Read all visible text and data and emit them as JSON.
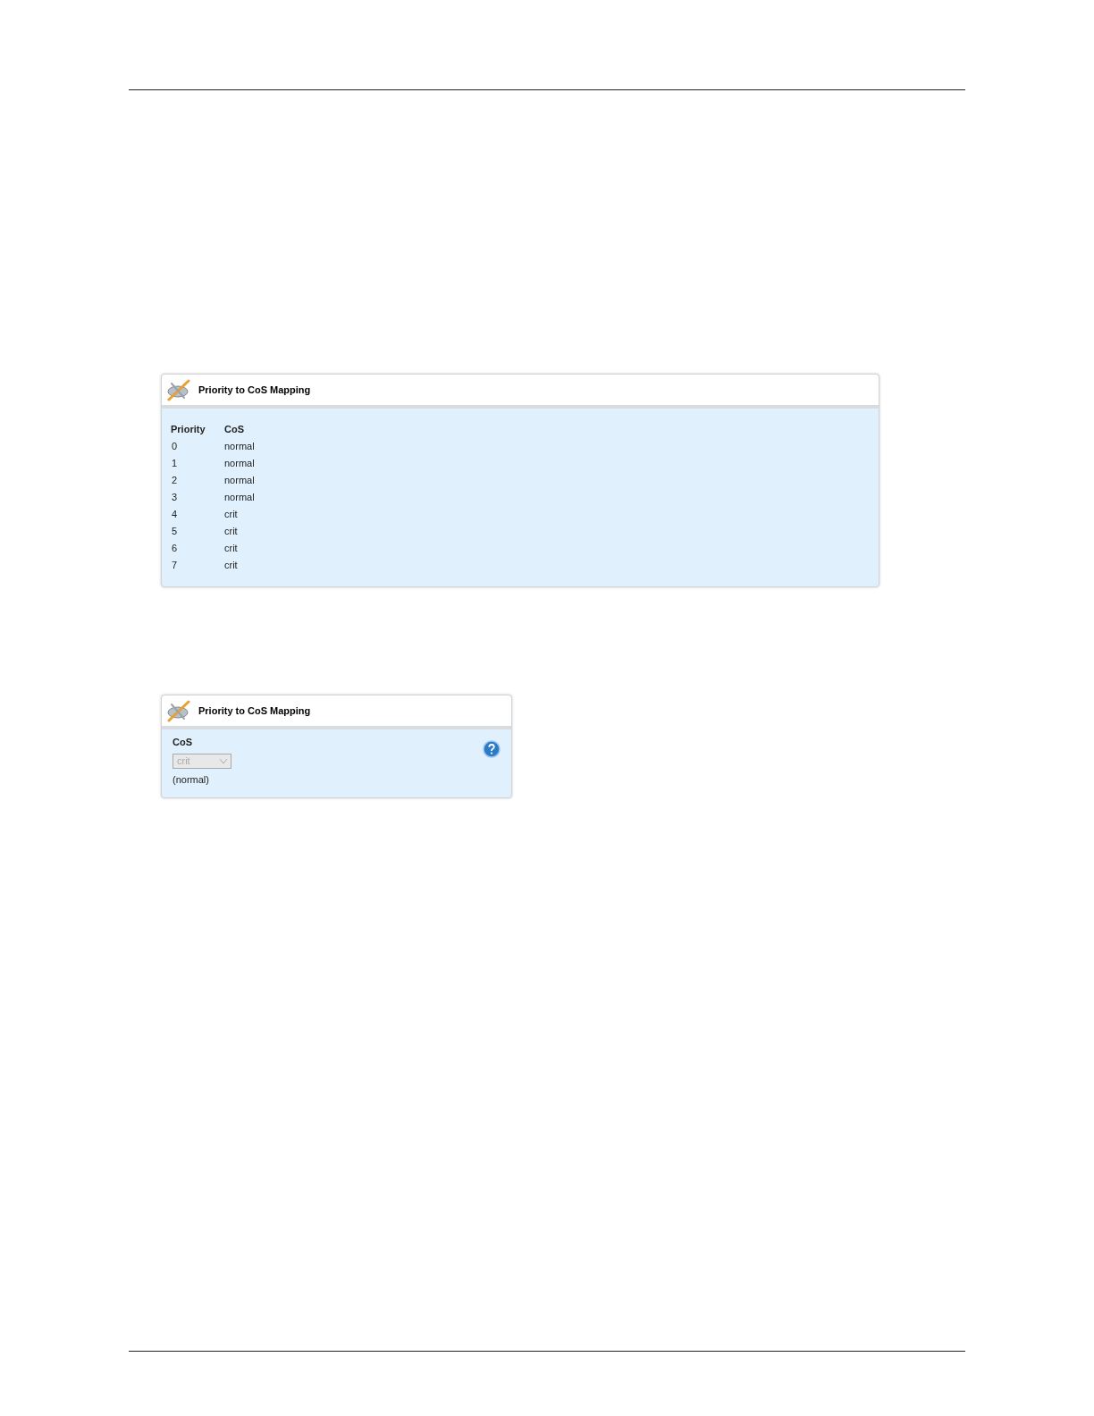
{
  "table_panel": {
    "title": "Priority to CoS Mapping",
    "columns": [
      "Priority",
      "CoS"
    ],
    "rows": [
      [
        "0",
        "normal"
      ],
      [
        "1",
        "normal"
      ],
      [
        "2",
        "normal"
      ],
      [
        "3",
        "normal"
      ],
      [
        "4",
        "crit"
      ],
      [
        "5",
        "crit"
      ],
      [
        "6",
        "crit"
      ],
      [
        "7",
        "crit"
      ]
    ]
  },
  "edit_panel": {
    "title": "Priority to CoS Mapping",
    "field": {
      "label": "CoS",
      "value": "crit",
      "disabled": true,
      "default_note": "(normal)"
    }
  }
}
